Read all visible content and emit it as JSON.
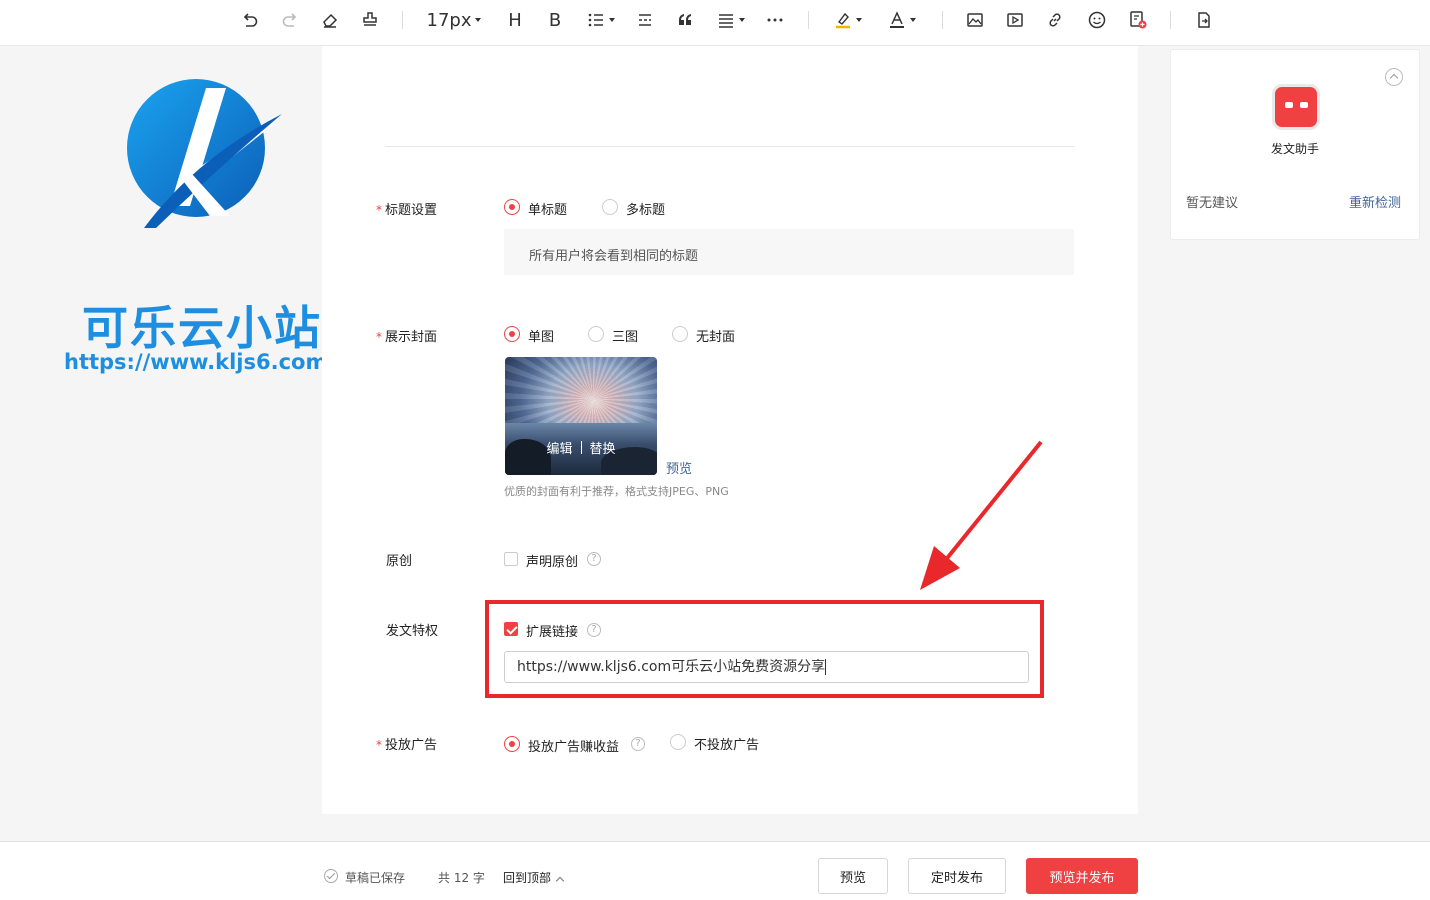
{
  "toolbar": {
    "font_size": "17px",
    "heading_glyph": "H",
    "bold_glyph": "B",
    "icons": [
      "undo-icon",
      "redo-icon",
      "eraser-icon",
      "format-painter-icon",
      "heading-icon",
      "bold-icon",
      "bullet-list-icon",
      "divider-icon",
      "quote-icon",
      "align-icon",
      "more-icon",
      "highlight-icon",
      "font-color-icon",
      "image-icon",
      "video-icon",
      "link-icon",
      "emoji-icon",
      "insert-card-icon",
      "import-doc-icon"
    ]
  },
  "watermark": {
    "title": "可乐云小站",
    "url": "https://www.kljs6.com/"
  },
  "form": {
    "title_setting": {
      "label": "标题设置",
      "options": [
        "单标题",
        "多标题"
      ],
      "selected": "单标题",
      "hint": "所有用户将会看到相同的标题"
    },
    "cover": {
      "label": "展示封面",
      "options": [
        "单图",
        "三图",
        "无封面"
      ],
      "selected": "单图",
      "edit": "编辑",
      "replace": "替换",
      "preview": "预览",
      "note": "优质的封面有利于推荐，格式支持JPEG、PNG"
    },
    "original": {
      "label": "原创",
      "checkbox": "声明原创",
      "checked": false
    },
    "privilege": {
      "label": "发文特权",
      "checkbox": "扩展链接",
      "checked": true,
      "link_value": "https://www.kljs6.com可乐云小站免费资源分享"
    },
    "ads": {
      "label": "投放广告",
      "options": [
        "投放广告赚收益",
        "不投放广告"
      ],
      "selected": "投放广告赚收益"
    }
  },
  "assistant": {
    "name": "发文助手",
    "empty": "暂无建议",
    "recheck": "重新检测"
  },
  "footer": {
    "saved": "草稿已保存",
    "word_count": "共 12 字",
    "back_top": "回到顶部",
    "preview": "预览",
    "schedule": "定时发布",
    "publish": "预览并发布"
  },
  "colors": {
    "accent": "#f04142",
    "link": "#406599",
    "annotation": "#e8282b",
    "logo": "#1e8fe0"
  }
}
